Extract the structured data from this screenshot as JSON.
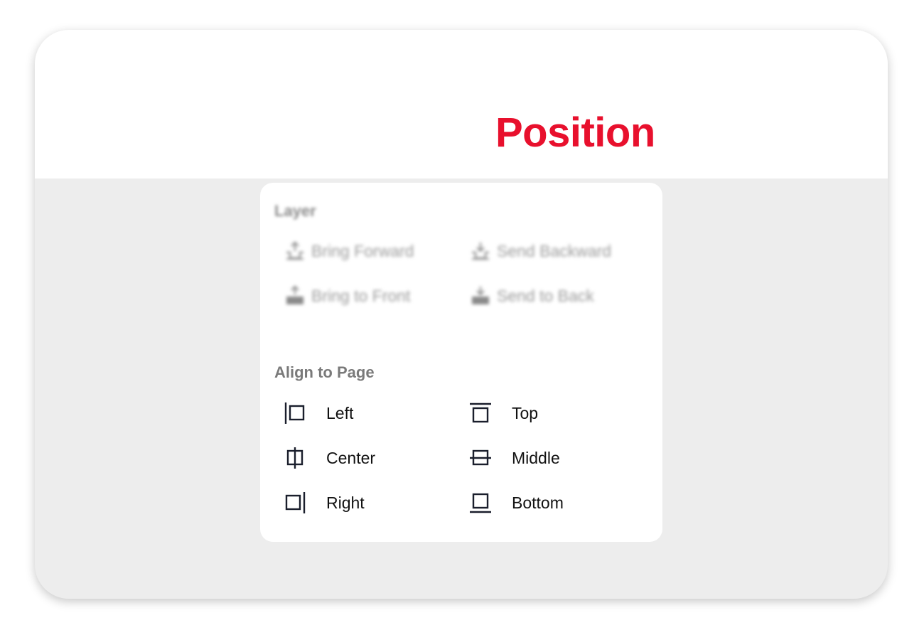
{
  "title": "Position",
  "colors": {
    "title": "#e8102d",
    "backdrop": "#ededed",
    "panel": "#ffffff"
  },
  "layer": {
    "label": "Layer",
    "items": [
      {
        "label": "Bring Forward",
        "icon": "bring-forward-icon"
      },
      {
        "label": "Send Backward",
        "icon": "send-backward-icon"
      },
      {
        "label": "Bring to Front",
        "icon": "bring-to-front-icon"
      },
      {
        "label": "Send to Back",
        "icon": "send-to-back-icon"
      }
    ]
  },
  "align": {
    "label": "Align to Page",
    "items": [
      {
        "label": "Left",
        "icon": "align-left-icon"
      },
      {
        "label": "Top",
        "icon": "align-top-icon"
      },
      {
        "label": "Center",
        "icon": "align-center-icon"
      },
      {
        "label": "Middle",
        "icon": "align-middle-icon"
      },
      {
        "label": "Right",
        "icon": "align-right-icon"
      },
      {
        "label": "Bottom",
        "icon": "align-bottom-icon"
      }
    ]
  }
}
